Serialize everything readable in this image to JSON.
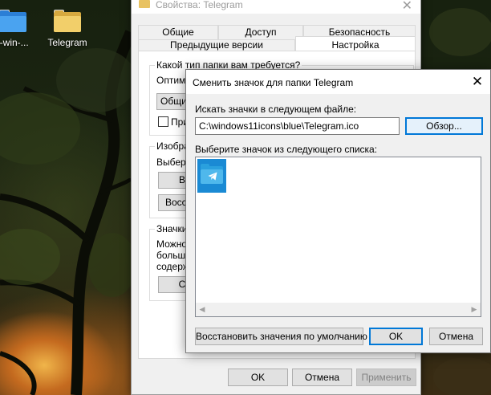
{
  "desktop": {
    "icons": [
      {
        "label": "t-win-..."
      },
      {
        "label": "Telegram"
      }
    ]
  },
  "properties_dialog": {
    "title": "Свойства: Telegram",
    "tabs_row1": [
      "Общие",
      "Доступ",
      "Безопасность"
    ],
    "tabs_row2": [
      "Предыдущие версии",
      "Настройка"
    ],
    "active_tab": "Настройка",
    "group1_label": "Какой тип папки вам требуется?",
    "optimize_label": "Оптими",
    "type_button": "Общие",
    "apply_check_label": "При",
    "group2_label": "Изобра",
    "choose_label": "Выбери",
    "file_button": "В",
    "restore_button": "Восс",
    "group3_label": "Значки",
    "can_text": [
      "Можно",
      "больше",
      "содерж"
    ],
    "change_icon_button": "С",
    "ok": "OK",
    "cancel": "Отмена",
    "apply": "Применить"
  },
  "change_icon_dialog": {
    "title": "Сменить значок для папки Telegram",
    "close": "✕",
    "search_label": "Искать значки в следующем файле:",
    "path_value": "C:\\windows11icons\\blue\\Telegram.ico",
    "browse": "Обзор...",
    "list_label": "Выберите значок из следующего списка:",
    "restore_defaults": "Восстановить значения по умолчанию",
    "ok": "OK",
    "cancel": "Отмена"
  },
  "colors": {
    "accent": "#0078d7",
    "selected_icon_bg": "#1a8ad4",
    "folder_yellow": "#e8c262"
  }
}
